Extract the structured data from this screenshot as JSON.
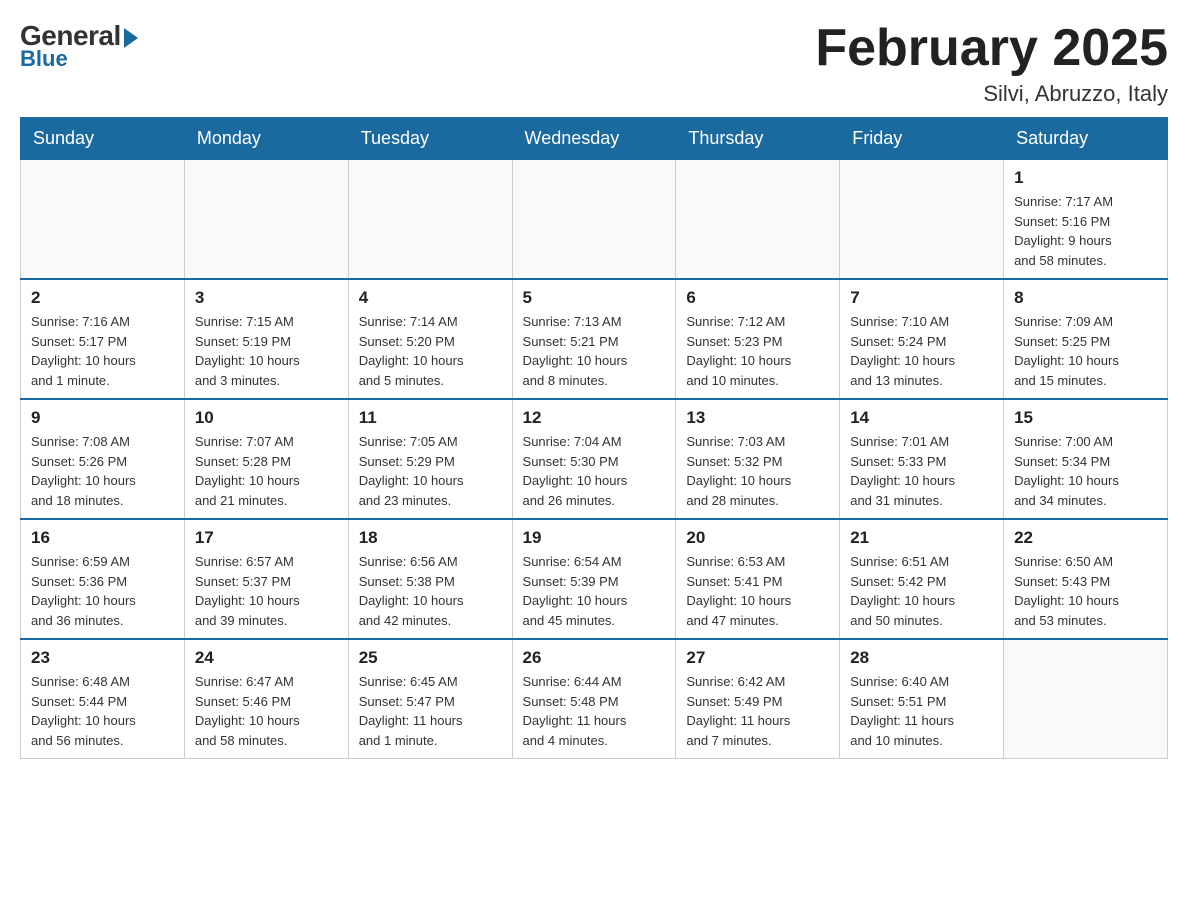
{
  "logo": {
    "general": "General",
    "blue": "Blue"
  },
  "header": {
    "title": "February 2025",
    "subtitle": "Silvi, Abruzzo, Italy"
  },
  "weekdays": [
    "Sunday",
    "Monday",
    "Tuesday",
    "Wednesday",
    "Thursday",
    "Friday",
    "Saturday"
  ],
  "weeks": [
    [
      {
        "day": "",
        "info": ""
      },
      {
        "day": "",
        "info": ""
      },
      {
        "day": "",
        "info": ""
      },
      {
        "day": "",
        "info": ""
      },
      {
        "day": "",
        "info": ""
      },
      {
        "day": "",
        "info": ""
      },
      {
        "day": "1",
        "info": "Sunrise: 7:17 AM\nSunset: 5:16 PM\nDaylight: 9 hours\nand 58 minutes."
      }
    ],
    [
      {
        "day": "2",
        "info": "Sunrise: 7:16 AM\nSunset: 5:17 PM\nDaylight: 10 hours\nand 1 minute."
      },
      {
        "day": "3",
        "info": "Sunrise: 7:15 AM\nSunset: 5:19 PM\nDaylight: 10 hours\nand 3 minutes."
      },
      {
        "day": "4",
        "info": "Sunrise: 7:14 AM\nSunset: 5:20 PM\nDaylight: 10 hours\nand 5 minutes."
      },
      {
        "day": "5",
        "info": "Sunrise: 7:13 AM\nSunset: 5:21 PM\nDaylight: 10 hours\nand 8 minutes."
      },
      {
        "day": "6",
        "info": "Sunrise: 7:12 AM\nSunset: 5:23 PM\nDaylight: 10 hours\nand 10 minutes."
      },
      {
        "day": "7",
        "info": "Sunrise: 7:10 AM\nSunset: 5:24 PM\nDaylight: 10 hours\nand 13 minutes."
      },
      {
        "day": "8",
        "info": "Sunrise: 7:09 AM\nSunset: 5:25 PM\nDaylight: 10 hours\nand 15 minutes."
      }
    ],
    [
      {
        "day": "9",
        "info": "Sunrise: 7:08 AM\nSunset: 5:26 PM\nDaylight: 10 hours\nand 18 minutes."
      },
      {
        "day": "10",
        "info": "Sunrise: 7:07 AM\nSunset: 5:28 PM\nDaylight: 10 hours\nand 21 minutes."
      },
      {
        "day": "11",
        "info": "Sunrise: 7:05 AM\nSunset: 5:29 PM\nDaylight: 10 hours\nand 23 minutes."
      },
      {
        "day": "12",
        "info": "Sunrise: 7:04 AM\nSunset: 5:30 PM\nDaylight: 10 hours\nand 26 minutes."
      },
      {
        "day": "13",
        "info": "Sunrise: 7:03 AM\nSunset: 5:32 PM\nDaylight: 10 hours\nand 28 minutes."
      },
      {
        "day": "14",
        "info": "Sunrise: 7:01 AM\nSunset: 5:33 PM\nDaylight: 10 hours\nand 31 minutes."
      },
      {
        "day": "15",
        "info": "Sunrise: 7:00 AM\nSunset: 5:34 PM\nDaylight: 10 hours\nand 34 minutes."
      }
    ],
    [
      {
        "day": "16",
        "info": "Sunrise: 6:59 AM\nSunset: 5:36 PM\nDaylight: 10 hours\nand 36 minutes."
      },
      {
        "day": "17",
        "info": "Sunrise: 6:57 AM\nSunset: 5:37 PM\nDaylight: 10 hours\nand 39 minutes."
      },
      {
        "day": "18",
        "info": "Sunrise: 6:56 AM\nSunset: 5:38 PM\nDaylight: 10 hours\nand 42 minutes."
      },
      {
        "day": "19",
        "info": "Sunrise: 6:54 AM\nSunset: 5:39 PM\nDaylight: 10 hours\nand 45 minutes."
      },
      {
        "day": "20",
        "info": "Sunrise: 6:53 AM\nSunset: 5:41 PM\nDaylight: 10 hours\nand 47 minutes."
      },
      {
        "day": "21",
        "info": "Sunrise: 6:51 AM\nSunset: 5:42 PM\nDaylight: 10 hours\nand 50 minutes."
      },
      {
        "day": "22",
        "info": "Sunrise: 6:50 AM\nSunset: 5:43 PM\nDaylight: 10 hours\nand 53 minutes."
      }
    ],
    [
      {
        "day": "23",
        "info": "Sunrise: 6:48 AM\nSunset: 5:44 PM\nDaylight: 10 hours\nand 56 minutes."
      },
      {
        "day": "24",
        "info": "Sunrise: 6:47 AM\nSunset: 5:46 PM\nDaylight: 10 hours\nand 58 minutes."
      },
      {
        "day": "25",
        "info": "Sunrise: 6:45 AM\nSunset: 5:47 PM\nDaylight: 11 hours\nand 1 minute."
      },
      {
        "day": "26",
        "info": "Sunrise: 6:44 AM\nSunset: 5:48 PM\nDaylight: 11 hours\nand 4 minutes."
      },
      {
        "day": "27",
        "info": "Sunrise: 6:42 AM\nSunset: 5:49 PM\nDaylight: 11 hours\nand 7 minutes."
      },
      {
        "day": "28",
        "info": "Sunrise: 6:40 AM\nSunset: 5:51 PM\nDaylight: 11 hours\nand 10 minutes."
      },
      {
        "day": "",
        "info": ""
      }
    ]
  ]
}
